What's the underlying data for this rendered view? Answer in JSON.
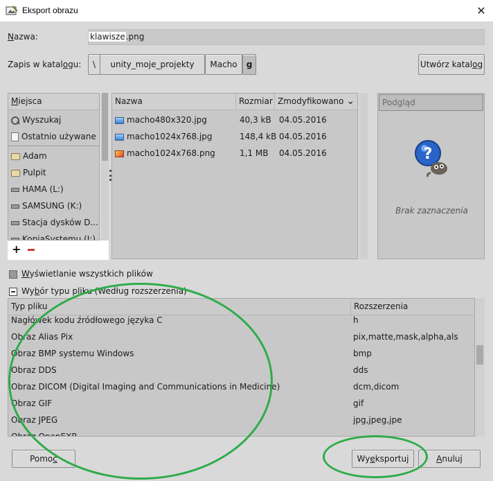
{
  "window": {
    "title": "Eksport obrazu",
    "close_glyph": "✕"
  },
  "name_row": {
    "label_prefix": "N",
    "label_rest": "azwa:",
    "value_selected": "klawisze",
    "value_ext": ".png"
  },
  "path_row": {
    "label_main": "Zapis w katal",
    "label_u": "o",
    "label_end": "gu:",
    "segments": [
      "\\",
      "unity_moje_projekty",
      "Macho",
      "g"
    ],
    "create_dir_main": "Utwórz katal",
    "create_dir_u": "o",
    "create_dir_end": "g"
  },
  "places": {
    "header_u": "M",
    "header_rest": "iejsca",
    "items": [
      {
        "label": "Wyszukaj",
        "icon": "search-icon"
      },
      {
        "label": "Ostatnio używane",
        "icon": "recent-icon"
      },
      {
        "label": "Adam",
        "icon": "folder-icon"
      },
      {
        "label": "Pulpit",
        "icon": "folder-icon"
      },
      {
        "label": "HAMA (L:)",
        "icon": "drive-icon"
      },
      {
        "label": "SAMSUNG (K:)",
        "icon": "drive-icon"
      },
      {
        "label": "Stacja dysków D...",
        "icon": "drive-icon"
      },
      {
        "label": "KopiaSystemu (I:)",
        "icon": "drive-icon"
      }
    ],
    "add_glyph": "+"
  },
  "files": {
    "columns": [
      "Nazwa",
      "Rozmiar",
      "Zmodyfikowano"
    ],
    "sort_glyph": "⌄",
    "rows": [
      {
        "name": "macho480x320.jpg",
        "size": "40,3 kB",
        "modified": "04.05.2016",
        "icon": "jpg-icon"
      },
      {
        "name": "macho1024x768.jpg",
        "size": "148,4 kB",
        "modified": "04.05.2016",
        "icon": "jpg-icon"
      },
      {
        "name": "macho1024x768.png",
        "size": "1,1 MB",
        "modified": "04.05.2016",
        "icon": "png-icon"
      }
    ]
  },
  "preview": {
    "header": "Podgląd",
    "empty_text": "Brak zaznaczenia"
  },
  "show_all": {
    "label_u": "W",
    "label_rest": "yświetlanie wszystkich plików"
  },
  "file_type": {
    "label_pre": "Wy",
    "label_u": "b",
    "label_rest": "ór typu pliku (Według rozszerzenia)"
  },
  "types": {
    "columns": [
      "Typ pliku",
      "Rozszerzenia"
    ],
    "rows": [
      {
        "type": "Nagłówek kodu źródłowego języka C",
        "ext": "h"
      },
      {
        "type": "Obraz Alias Pix",
        "ext": "pix,matte,mask,alpha,als"
      },
      {
        "type": "Obraz BMP systemu Windows",
        "ext": "bmp"
      },
      {
        "type": "Obraz DDS",
        "ext": "dds"
      },
      {
        "type": "Obraz DICOM (Digital Imaging and Communications in Medicine)",
        "ext": "dcm,dicom"
      },
      {
        "type": "Obraz GIF",
        "ext": "gif"
      },
      {
        "type": "Obraz JPEG",
        "ext": "jpg,jpeg,jpe"
      },
      {
        "type": "Obraz OpenEXR",
        "ext": ""
      }
    ]
  },
  "buttons": {
    "help_pre": "Pomo",
    "help_u": "c",
    "export_pre": "Wy",
    "export_u": "e",
    "export_rest": "ksportuj",
    "cancel_u": "A",
    "cancel_rest": "nuluj"
  },
  "colors": {
    "annotation": "#2eac4a",
    "dialog_bg": "#d9d9d9"
  }
}
